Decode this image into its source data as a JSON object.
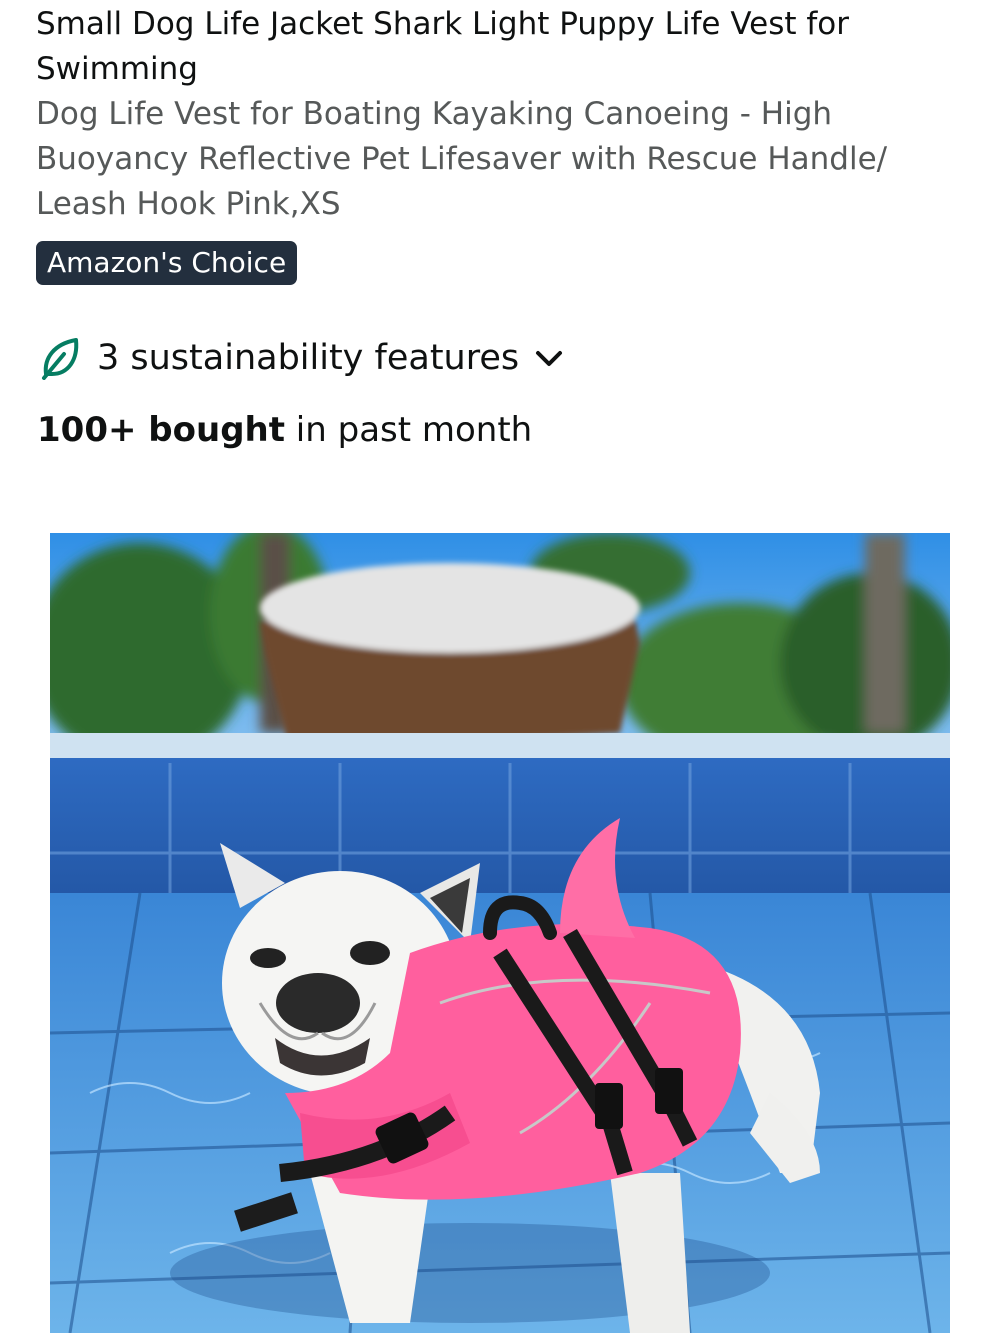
{
  "product": {
    "title_brand": "Small Dog Life Jacket Shark Light Puppy Life Vest for Swimming",
    "title_rest": "Dog Life Vest for Boating Kayaking Canoeing - High Buoyancy Reflective Pet Lifesaver with Rescue Handle/ Leash Hook Pink,XS",
    "badge": "Amazon's Choice",
    "sustainability": {
      "label": "3 sustainability features",
      "icon": "leaf-icon",
      "expand_icon": "chevron-down-icon"
    },
    "bought": {
      "count": "100+ bought",
      "suffix": " in past month"
    },
    "image": {
      "subject": "dog-life-vest-photo"
    }
  },
  "colors": {
    "badge_bg": "#232f3e",
    "leaf": "#067d62",
    "vest_pink": "#ff5f9e",
    "pool_blue": "#2f7fd0"
  }
}
